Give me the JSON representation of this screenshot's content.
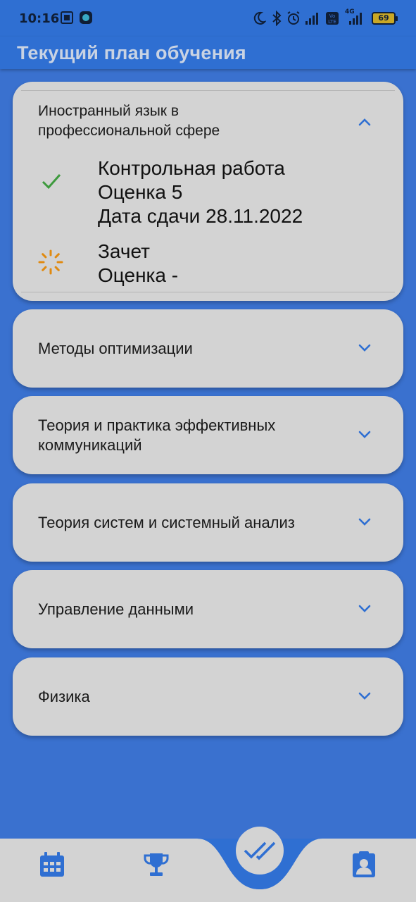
{
  "status_bar": {
    "time": "10:16",
    "battery": "69",
    "network": "4G"
  },
  "header": {
    "title": "Текущий план обучения"
  },
  "subjects": [
    {
      "name": "Иностранный язык в\nпрофессиональной сфере",
      "expanded": true,
      "items": [
        {
          "status": "check-icon",
          "lines": [
            "Контрольная работа",
            "Оценка 5",
            "Дата сдачи 28.11.2022"
          ]
        },
        {
          "status": "loading-icon",
          "lines": [
            "Зачет",
            "Оценка -"
          ]
        }
      ]
    },
    {
      "name": "Методы оптимизации",
      "expanded": false
    },
    {
      "name": "Теория и практика эффективных\nкоммуникаций",
      "expanded": false
    },
    {
      "name": "Теория систем и системный анализ",
      "expanded": false
    },
    {
      "name": "Управление данными",
      "expanded": false
    },
    {
      "name": "Физика",
      "expanded": false
    }
  ],
  "bottom_nav": {
    "items": [
      {
        "icon": "calendar-icon"
      },
      {
        "icon": "trophy-icon"
      },
      {
        "icon": "double-check-icon",
        "active": true
      },
      {
        "icon": "profile-icon"
      }
    ]
  },
  "colors": {
    "background": "#3a71cf",
    "app_bar": "#2f6fd2",
    "card": "#d3d3d3",
    "accent": "#2f6fd2",
    "check": "#3d9a3d",
    "loading": "#e08a10"
  }
}
